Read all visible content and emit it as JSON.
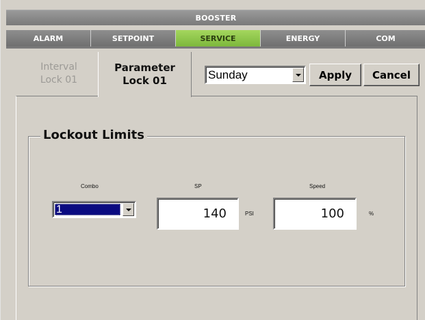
{
  "header": {
    "title": "BOOSTER"
  },
  "nav_tabs": [
    {
      "label": "ALARM",
      "active": false
    },
    {
      "label": "SETPOINT",
      "active": false
    },
    {
      "label": "SERVICE",
      "active": true
    },
    {
      "label": "ENERGY",
      "active": false
    },
    {
      "label": "COM",
      "active": false
    }
  ],
  "sub_tabs": [
    {
      "line1": "Interval",
      "line2": "Lock 01",
      "active": false
    },
    {
      "line1": "Parameter",
      "line2": "Lock 01",
      "active": true
    }
  ],
  "toolbar": {
    "day_selected": "Sunday",
    "apply_label": "Apply",
    "cancel_label": "Cancel"
  },
  "lockout": {
    "group_title": "Lockout Limits",
    "combo_label": "Combo",
    "combo_value": "1",
    "sp_label": "SP",
    "sp_value": "140",
    "sp_unit": "PSI",
    "speed_label": "Speed",
    "speed_value": "100",
    "speed_unit": "%"
  },
  "colors": {
    "background": "#d4d0c8",
    "header_bar": "#858585",
    "active_tab": "#8fc74a",
    "selection": "#0a0a80"
  },
  "icons": {
    "dropdown": "chevron-down-icon"
  }
}
